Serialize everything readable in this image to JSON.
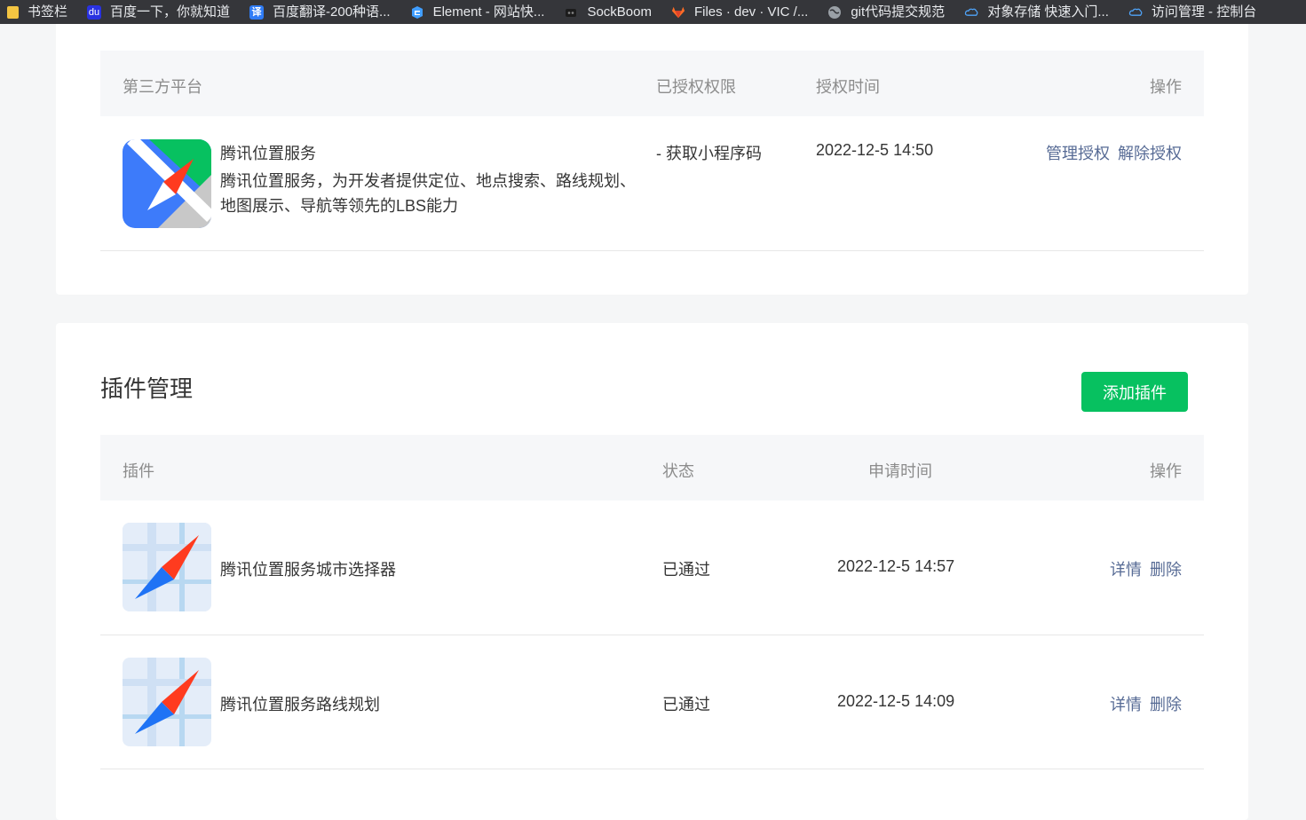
{
  "bookmarks": [
    {
      "icon": "folder-icon",
      "label": "书签栏"
    },
    {
      "icon": "baidu-icon",
      "label": "百度一下，你就知道"
    },
    {
      "icon": "translate-icon",
      "label": "百度翻译-200种语..."
    },
    {
      "icon": "element-icon",
      "label": "Element - 网站快..."
    },
    {
      "icon": "sockboom-icon",
      "label": "SockBoom"
    },
    {
      "icon": "gitlab-icon",
      "label": "Files · dev · VIC /..."
    },
    {
      "icon": "globe-icon",
      "label": "git代码提交规范"
    },
    {
      "icon": "cloud-icon",
      "label": "对象存储 快速入门..."
    },
    {
      "icon": "cloud-icon",
      "label": "访问管理 - 控制台"
    }
  ],
  "auth": {
    "headers": {
      "platform": "第三方平台",
      "permissions": "已授权权限",
      "time": "授权时间",
      "actions": "操作"
    },
    "rows": [
      {
        "name": "腾讯位置服务",
        "desc": "腾讯位置服务，为开发者提供定位、地点搜索、路线规划、地图展示、导航等领先的LBS能力",
        "permission": "- 获取小程序码",
        "time": "2022-12-5 14:50",
        "action_manage": "管理授权",
        "action_revoke": "解除授权"
      }
    ]
  },
  "plugins": {
    "title": "插件管理",
    "add_button": "添加插件",
    "headers": {
      "plugin": "插件",
      "status": "状态",
      "time": "申请时间",
      "actions": "操作"
    },
    "rows": [
      {
        "name": "腾讯位置服务城市选择器",
        "status": "已通过",
        "time": "2022-12-5 14:57",
        "detail": "详情",
        "delete": "删除"
      },
      {
        "name": "腾讯位置服务路线规划",
        "status": "已通过",
        "time": "2022-12-5 14:09",
        "detail": "详情",
        "delete": "删除"
      }
    ]
  },
  "colors": {
    "accent_green": "#07c160",
    "link": "#576b95",
    "header_bg": "#f6f7f9",
    "page_bg": "#f5f6f7"
  }
}
